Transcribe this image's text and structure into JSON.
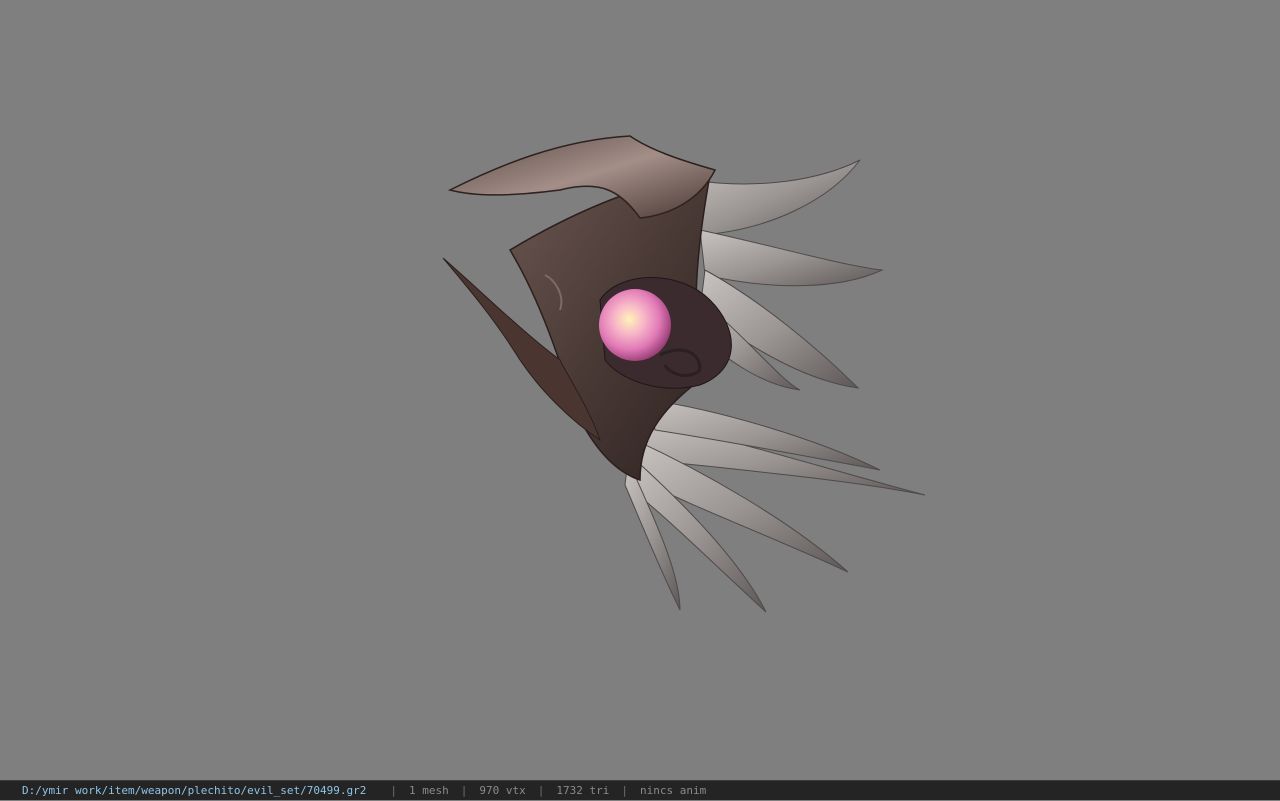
{
  "viewer": {
    "background_color": "#7f7f7f",
    "object": "3d-model-shield"
  },
  "status_bar": {
    "file_path": "D:/ymir work/item/weapon/plechito/evil_set/70499.gr2",
    "mesh_count": "1 mesh",
    "vertex_count": "970 vtx",
    "triangle_count": "1732 tri",
    "animation": "nincs anim",
    "separator": "|",
    "path_color": "#8fc3e6",
    "text_color": "#8a8a8a"
  }
}
